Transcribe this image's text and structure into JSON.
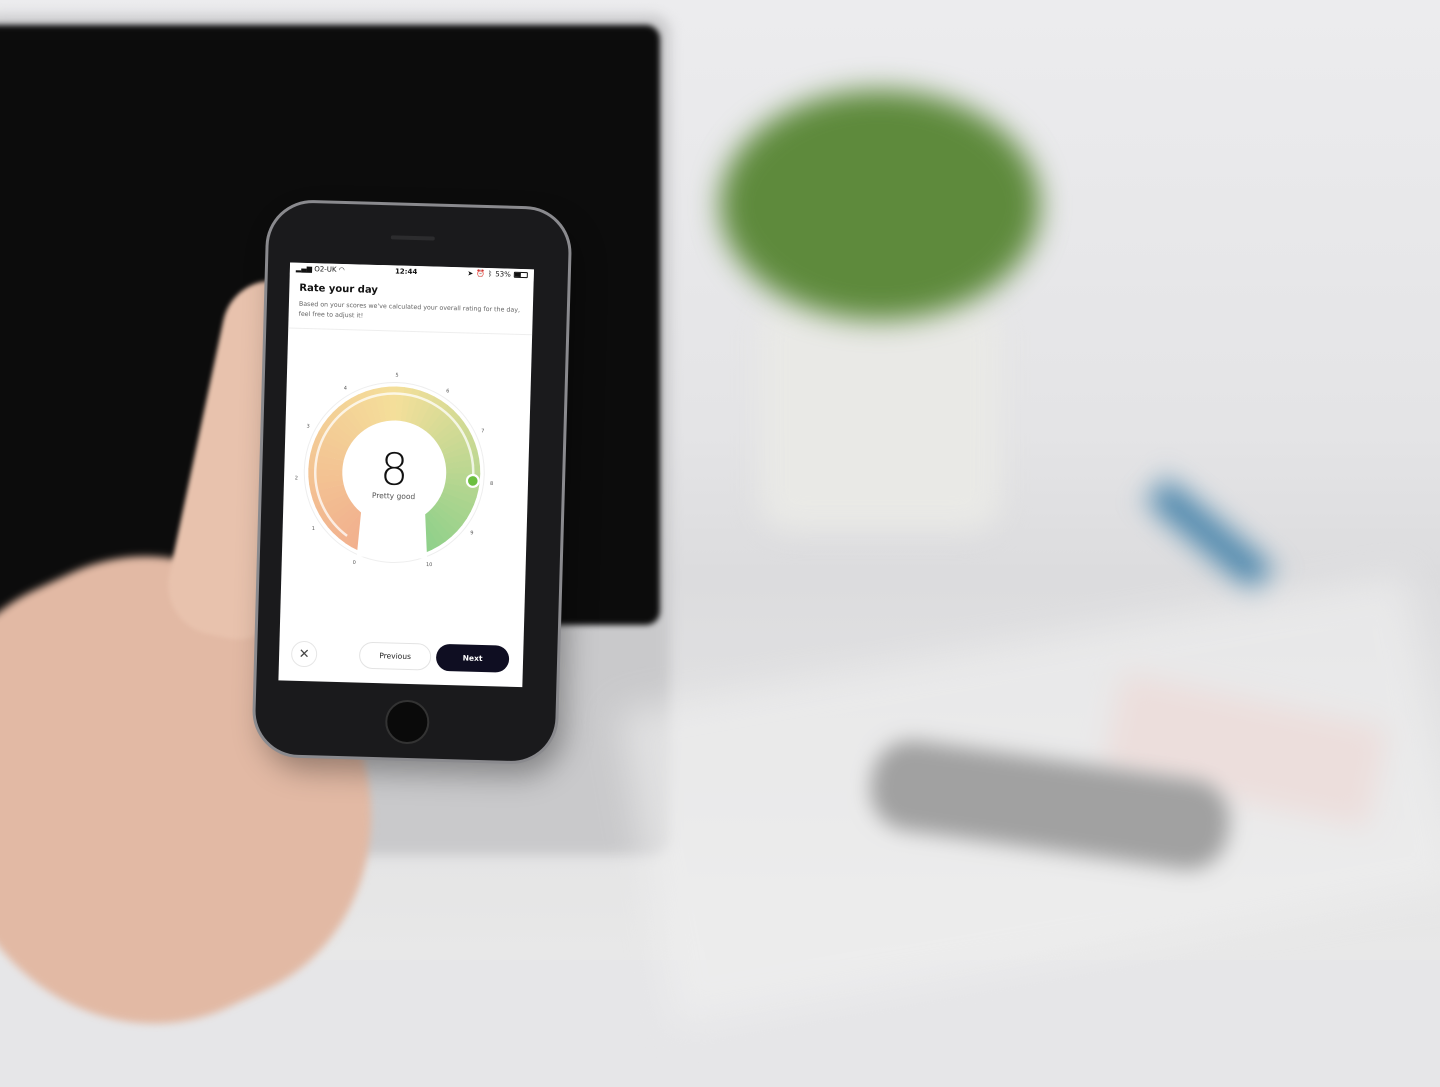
{
  "status_bar": {
    "carrier": "O2-UK",
    "time": "12:44",
    "battery": "53%",
    "battery_level": 0.53
  },
  "header": {
    "title": "Rate your day",
    "subtitle": "Based on your scores we've calculated your overall rating for the day, feel free to adjust it!"
  },
  "gauge": {
    "value": "8",
    "label": "Pretty good",
    "min": 0,
    "max": 10,
    "selected": 8,
    "ticks": [
      "0",
      "1",
      "2",
      "3",
      "4",
      "5",
      "6",
      "7",
      "8",
      "9",
      "10"
    ],
    "colors": {
      "low": "#f2b08e",
      "mid": "#f4df9a",
      "high": "#8fd08a",
      "knob": "#6cbf3f"
    }
  },
  "footer": {
    "close_icon": "close-icon",
    "previous_label": "Previous",
    "next_label": "Next"
  }
}
